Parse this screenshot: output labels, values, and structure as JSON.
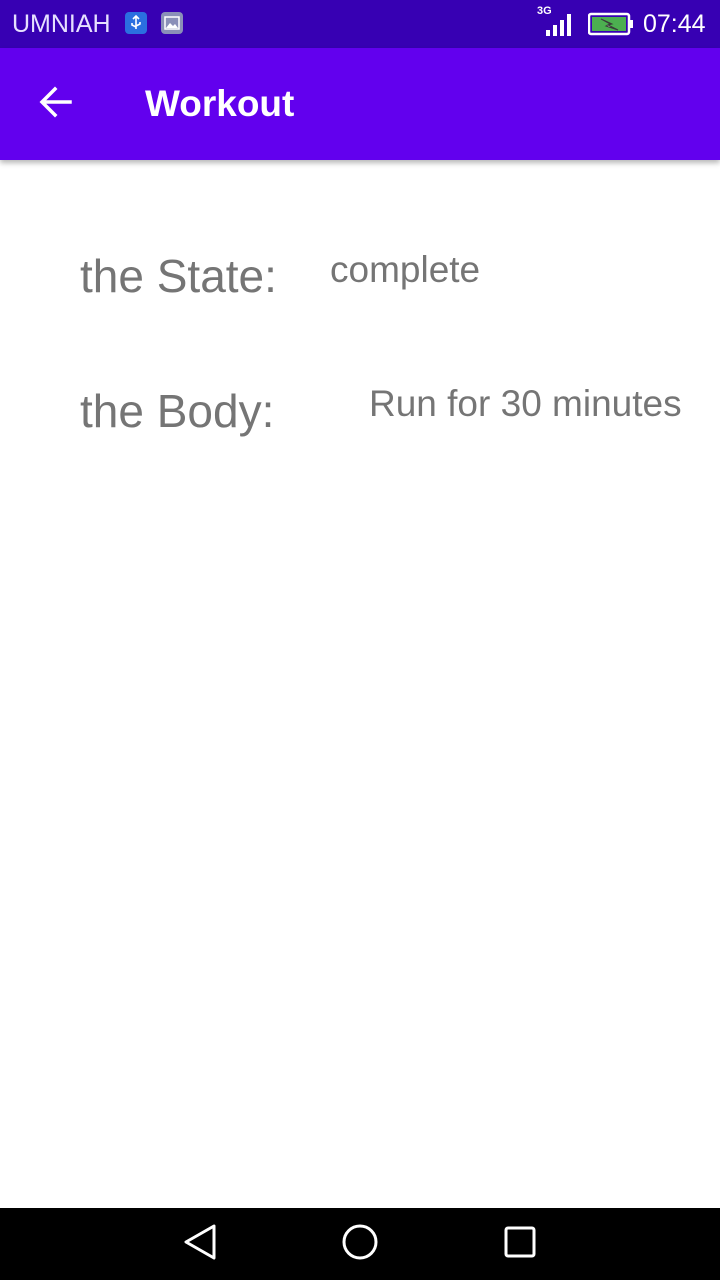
{
  "status_bar": {
    "carrier": "UMNIAH",
    "network_type": "3G",
    "time": "07:44",
    "icons": [
      "usb-icon",
      "image-icon",
      "signal-icon",
      "battery-charging-icon"
    ]
  },
  "toolbar": {
    "title": "Workout",
    "back_icon": "arrow-left-icon"
  },
  "details": {
    "state_label": "the State:",
    "state_value": "complete",
    "body_label": "the Body:",
    "body_value": "Run for 30 minutes"
  },
  "nav_bar": {
    "icons": [
      "nav-back-icon",
      "nav-home-icon",
      "nav-recents-icon"
    ]
  },
  "colors": {
    "status_bar": "#3700b3",
    "app_bar": "#6200ee",
    "text_secondary": "#757575",
    "nav_bar": "#000000"
  }
}
